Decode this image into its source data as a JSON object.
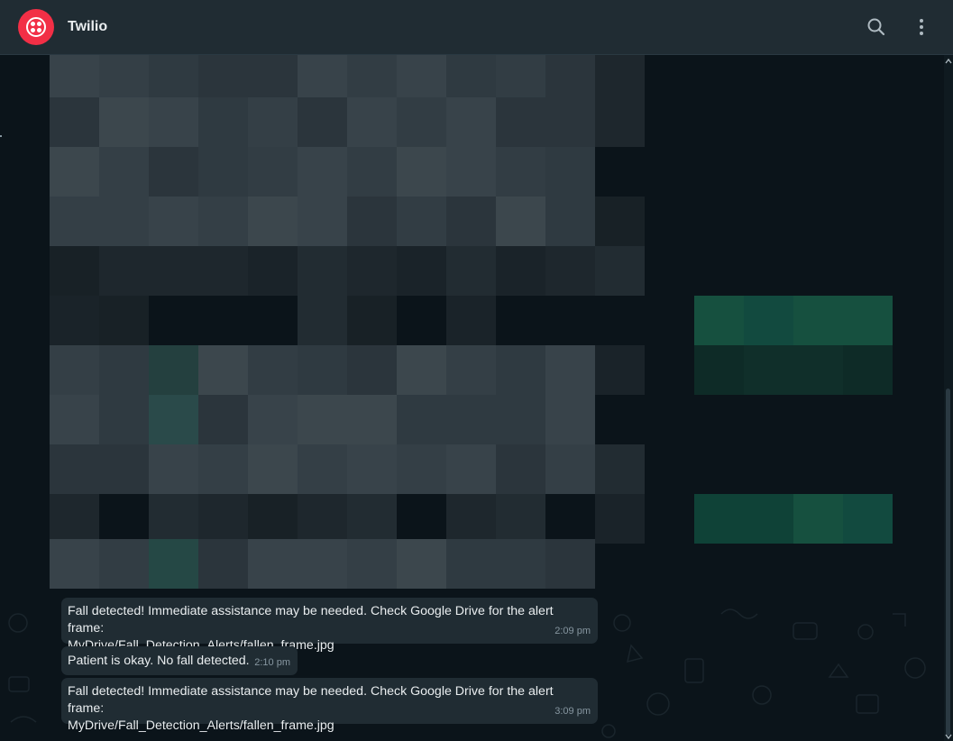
{
  "header": {
    "title": "Twilio",
    "avatar_icon": "twilio-logo-icon",
    "brand_color": "#f22f46",
    "search_icon": "search-icon",
    "menu_icon": "more-vertical-icon"
  },
  "messages": [
    {
      "line1": "Fall detected! Immediate assistance may be needed. Check Google Drive for the alert frame:",
      "line2": "MyDrive/Fall_Detection_Alerts/fallen_frame.jpg",
      "time": "2:09 pm"
    },
    {
      "line1": "Patient is okay. No fall detected.",
      "time": "2:10 pm"
    },
    {
      "line1": "Fall detected! Immediate assistance may be needed. Check Google Drive for the alert frame:",
      "line2": "MyDrive/Fall_Detection_Alerts/fallen_frame.jpg",
      "time": "3:09 pm"
    }
  ],
  "colors": {
    "background": "#0b141a",
    "header": "#202c33",
    "incoming_bubble": "#202c33",
    "outgoing_bubble": "#005c4b",
    "primary_text": "#e9edef",
    "secondary_text": "#8696a0"
  }
}
